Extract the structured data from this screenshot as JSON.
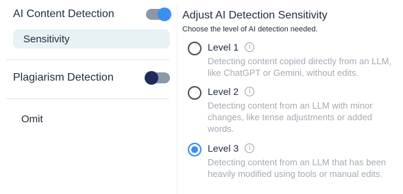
{
  "sidebar": {
    "ai_detection": {
      "label": "AI Content Detection",
      "enabled": true
    },
    "sensitivity_label": "Sensitivity",
    "plagiarism": {
      "label": "Plagiarism Detection",
      "enabled": false
    },
    "omit_label": "Omit"
  },
  "panel": {
    "title": "Adjust AI Detection Sensitivity",
    "subtitle": "Choose the level of AI detection needed.",
    "options": [
      {
        "label": "Level 1",
        "description": "Detecting content copied directly from an LLM, like ChatGPT or Gemini, without edits.",
        "selected": false
      },
      {
        "label": "Level 2",
        "description": "Detecting content from an LLM with minor changes, like tense adjustments or added words.",
        "selected": false
      },
      {
        "label": "Level 3",
        "description": "Detecting content from an LLM that has been heavily modified using tools or manual edits.",
        "selected": true
      }
    ]
  },
  "colors": {
    "accent": "#3d8ef0",
    "toggle_off_knob": "#1f2a5c",
    "pill_bg": "#e8f1f4",
    "muted_text": "#a4abb4"
  },
  "icons": {
    "info": "info-icon"
  }
}
